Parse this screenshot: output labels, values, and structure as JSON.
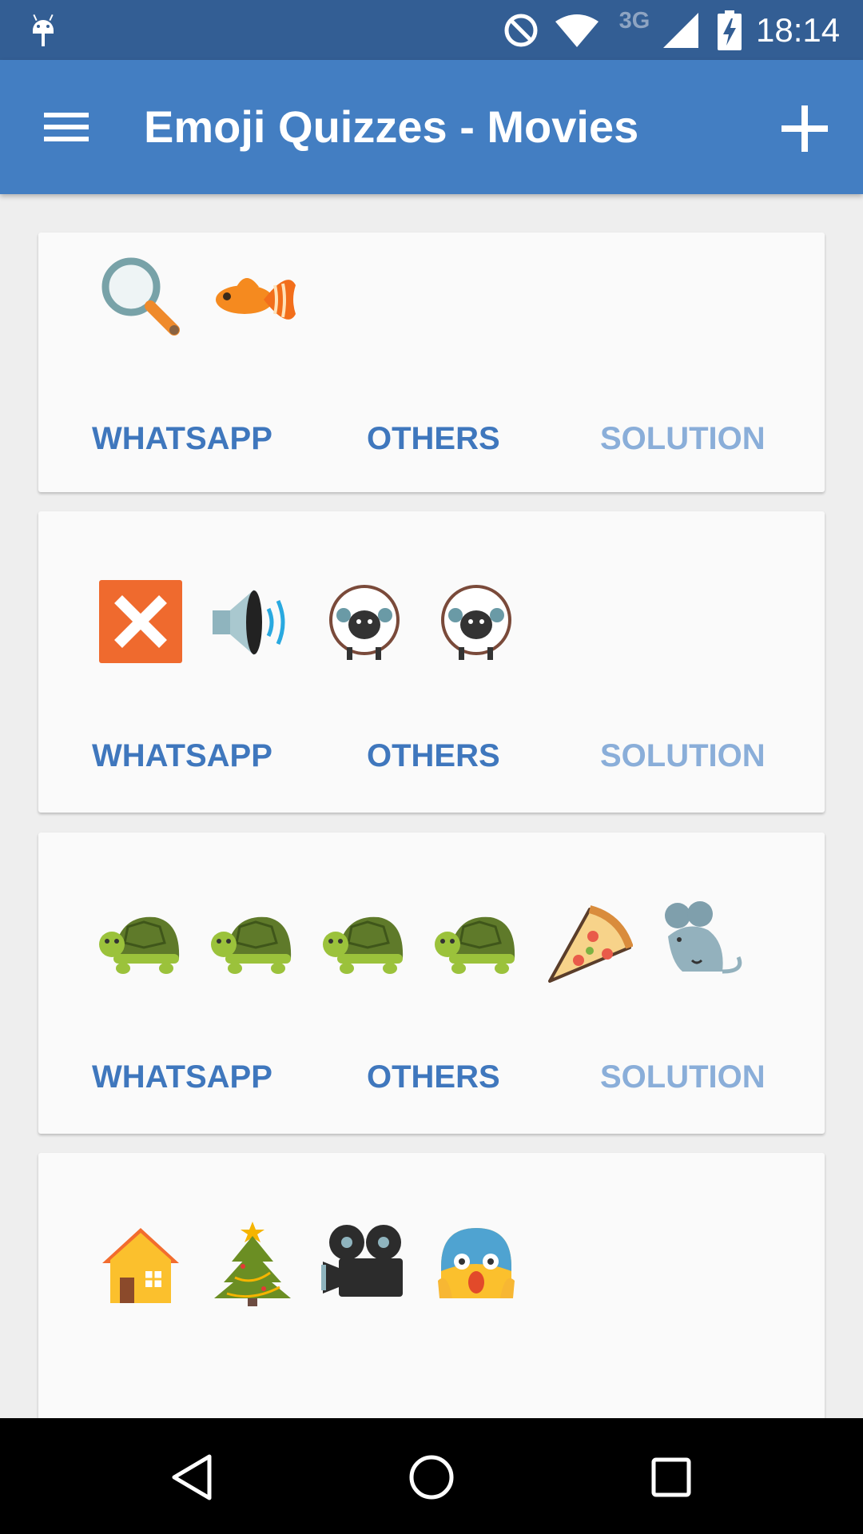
{
  "status_bar": {
    "network_type": "3G",
    "time": "18:14",
    "icons": [
      "android-notification-icon",
      "do-not-disturb-icon",
      "wifi-icon",
      "signal-icon",
      "battery-charging-icon"
    ]
  },
  "app_bar": {
    "title": "Emoji Quizzes - Movies",
    "menu_icon": "hamburger-menu-icon",
    "action_icon": "add-icon"
  },
  "colors": {
    "status_bar": "#335e94",
    "app_bar": "#437ec2",
    "background": "#eeeeee",
    "card": "#fafafa",
    "action_text": "#3f77bd",
    "solution_text": "#8aaed9"
  },
  "quizzes": [
    {
      "emojis": [
        "magnifying-glass",
        "tropical-fish"
      ],
      "actions": {
        "whatsapp": "WHATSAPP",
        "others": "OTHERS",
        "solution": "SOLUTION"
      }
    },
    {
      "emojis": [
        "cross-mark",
        "speaker",
        "sheep",
        "sheep"
      ],
      "actions": {
        "whatsapp": "WHATSAPP",
        "others": "OTHERS",
        "solution": "SOLUTION"
      }
    },
    {
      "emojis": [
        "turtle",
        "turtle",
        "turtle",
        "turtle",
        "pizza",
        "mouse"
      ],
      "actions": {
        "whatsapp": "WHATSAPP",
        "others": "OTHERS",
        "solution": "SOLUTION"
      }
    },
    {
      "emojis": [
        "house",
        "christmas-tree",
        "movie-camera",
        "screaming-face"
      ]
    }
  ],
  "nav_bar": {
    "buttons": [
      "back-icon",
      "home-icon",
      "recents-icon"
    ]
  }
}
